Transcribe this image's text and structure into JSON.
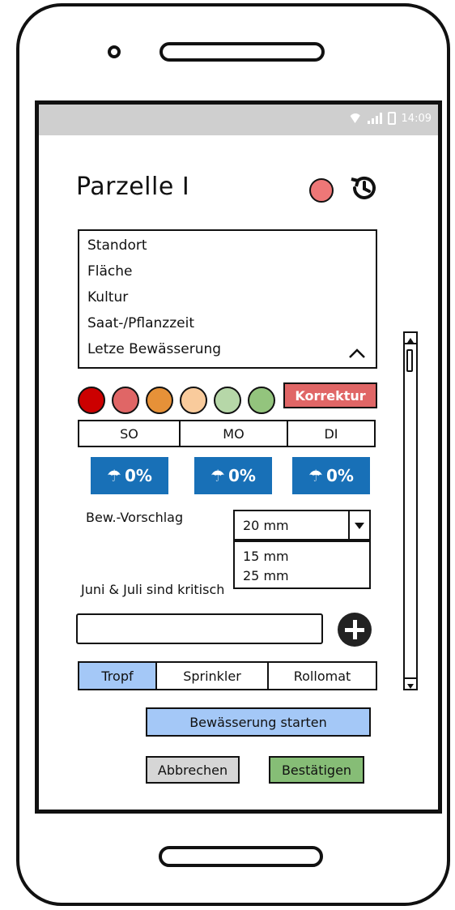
{
  "status_bar": {
    "time": "14:09",
    "bg": "#cfcfcf"
  },
  "header": {
    "title": "Parzelle I",
    "status_color": "#ee7777"
  },
  "info_list": {
    "items": [
      "Standort",
      "Fläche",
      "Kultur",
      "Saat-/Pflanzzeit",
      "Letze Bewässerung"
    ]
  },
  "status_colors": [
    "#cc0000",
    "#e06666",
    "#e69138",
    "#f9cb9c",
    "#b6d7a8",
    "#93c47d"
  ],
  "korrektur_label": "Korrektur",
  "days": [
    "SO",
    "MO",
    "DI"
  ],
  "rain": [
    {
      "value": "0%"
    },
    {
      "value": "0%"
    },
    {
      "value": "0%"
    }
  ],
  "bew_vorschlag": {
    "label": "Bew.-Vorschlag",
    "selected": "20 mm",
    "options": [
      "15 mm",
      "25 mm"
    ]
  },
  "hint": "Juni & Juli sind kritisch",
  "notes_input": {
    "value": "",
    "placeholder": ""
  },
  "irrigation_types": [
    {
      "label": "Tropf",
      "active": true
    },
    {
      "label": "Sprinkler",
      "active": false
    },
    {
      "label": "Rollomat",
      "active": false
    }
  ],
  "actions": {
    "start": "Bewässerung starten",
    "cancel": "Abbrechen",
    "confirm": "Bestätigen"
  }
}
